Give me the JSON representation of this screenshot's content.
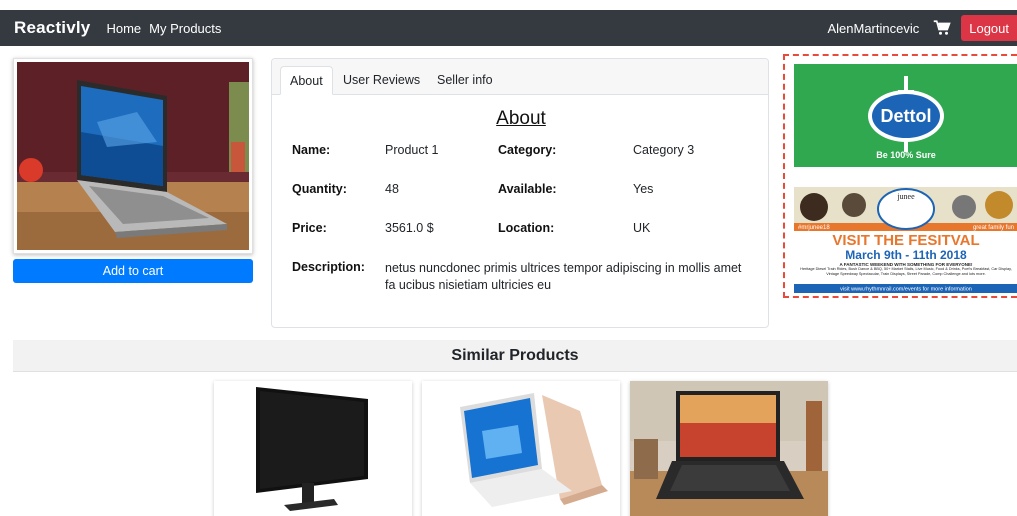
{
  "navbar": {
    "brand": "Reactivly",
    "links": [
      "Home",
      "My Products"
    ],
    "username": "AlenMartincevic",
    "logout_label": "Logout"
  },
  "product": {
    "add_to_cart_label": "Add to cart"
  },
  "tabs": [
    "About",
    "User Reviews",
    "Seller info"
  ],
  "about": {
    "title": "About",
    "name_label": "Name:",
    "name": "Product 1",
    "category_label": "Category:",
    "category": "Category 3",
    "quantity_label": "Quantity:",
    "quantity": "48",
    "available_label": "Available:",
    "available": "Yes",
    "price_label": "Price:",
    "price": "3561.0 $",
    "location_label": "Location:",
    "location": "UK",
    "description_label": "Description:",
    "description": "netus nuncdonec primis ultrices tempor adipiscing in mollis amet fa ucibus nisietiam ultricies eu"
  },
  "ads": {
    "ad1_brand": "Dettol",
    "ad1_tagline": "Be 100% Sure",
    "ad2_tag_left": "#mrjunee18",
    "ad2_tag_right": "great family fun",
    "ad2_name": "junee",
    "ad2_headline": "VISIT THE FESITVAL",
    "ad2_dates": "March 9th - 11th 2018",
    "ad2_sub": "A FANTASTIC WEEKEND WITH SOMETHING FOR EVERYONE!",
    "ad2_details": "Heritage Diesel Train Rides, Bush Dance & BBQ, 50+ Market Stalls, Live Music, Food & Drinks, Poet's Breakfast, Car Display, Vintage Speedway Spectacular, Train Displays, Street Parade, Comp Challenge and lots more.",
    "ad2_footer": "visit www.rhythmnrail.com/events for more information"
  },
  "similar": {
    "title": "Similar Products"
  },
  "colors": {
    "navbar_bg": "#343a40",
    "logout_bg": "#dc3545",
    "primary": "#007bff",
    "ad_border": "#e84b3a",
    "dettol_green": "#2fa84f"
  }
}
